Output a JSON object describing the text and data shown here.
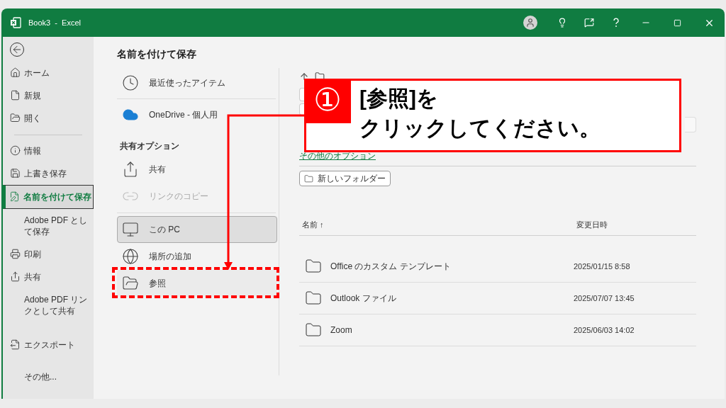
{
  "window": {
    "title": "Book3  -  Excel"
  },
  "sidebar": {
    "groups": [
      [
        {
          "label": "ホーム",
          "selected": false
        },
        {
          "label": "新規",
          "selected": false
        },
        {
          "label": "開く",
          "selected": false
        }
      ],
      [
        {
          "label": "情報",
          "selected": false
        },
        {
          "label": "上書き保存",
          "selected": false
        },
        {
          "label": "名前を付けて保存",
          "selected": true
        },
        {
          "label": "Adobe PDF として保存",
          "selected": false
        },
        {
          "label": "印刷",
          "selected": false
        },
        {
          "label": "共有",
          "selected": false
        },
        {
          "label": "Adobe PDF リンクとして共有",
          "selected": false
        }
      ],
      [
        {
          "label": "エクスポート",
          "selected": false
        }
      ],
      [
        {
          "label": "その他...",
          "selected": false
        }
      ]
    ]
  },
  "page_title": "名前を付けて保存",
  "locations": [
    {
      "kind": "item",
      "label": "最近使ったアイテム",
      "selected": false,
      "disabled": false
    },
    {
      "kind": "item",
      "label": "OneDrive - 個人用",
      "selected": false,
      "disabled": false
    },
    {
      "kind": "heading",
      "label": "共有オプション"
    },
    {
      "kind": "item",
      "label": "共有",
      "selected": false,
      "disabled": false
    },
    {
      "kind": "item",
      "label": "リンクのコピー",
      "selected": false,
      "disabled": true
    },
    {
      "kind": "item",
      "label": "この PC",
      "selected": true,
      "disabled": false
    },
    {
      "kind": "item",
      "label": "場所の追加",
      "selected": false,
      "disabled": false
    },
    {
      "kind": "item",
      "label": "参照",
      "selected": false,
      "disabled": false
    }
  ],
  "more_options_link": "その他のオプション",
  "new_folder_button": "新しいフォルダー",
  "file_table": {
    "columns": [
      "名前 ↑",
      "変更日時"
    ],
    "rows": [
      {
        "name": "Office のカスタム テンプレート",
        "modified": "2025/01/15 8:58"
      },
      {
        "name": "Outlook ファイル",
        "modified": "2025/07/07 13:45"
      },
      {
        "name": "Zoom",
        "modified": "2025/06/03 14:02"
      }
    ]
  },
  "callout": {
    "number": "①",
    "lines": [
      "[参照]を",
      "クリックしてください。"
    ]
  }
}
